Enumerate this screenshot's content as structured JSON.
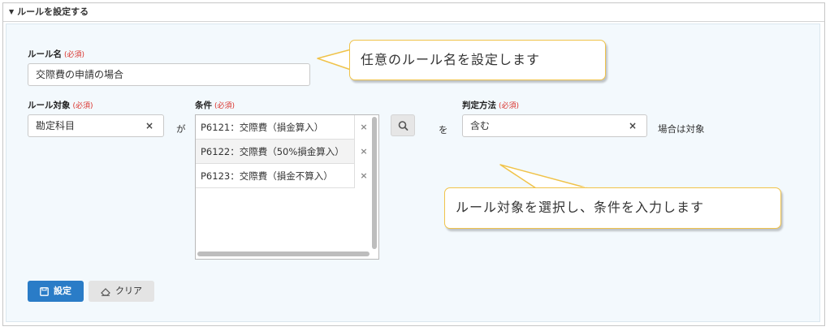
{
  "section": {
    "title": "ルールを設定する"
  },
  "rule_name": {
    "label": "ルール名",
    "required": "(必須)",
    "value": "交際費の申請の場合"
  },
  "rule_target": {
    "label": "ルール対象",
    "required": "(必須)",
    "value": "勘定科目",
    "clear": "×"
  },
  "particle_ga": "が",
  "condition": {
    "label": "条件",
    "required": "(必須)",
    "items": [
      {
        "label": "P6121：交際費（損金算入）",
        "remove": "×"
      },
      {
        "label": "P6122：交際費（50%損金算入）",
        "remove": "×"
      },
      {
        "label": "P6123：交際費（損金不算入）",
        "remove": "×"
      }
    ]
  },
  "particle_wo": "を",
  "judgement": {
    "label": "判定方法",
    "required": "(必須)",
    "value": "含む",
    "clear": "×",
    "suffix": "場合は対象"
  },
  "callouts": {
    "rule_name_hint": "任意のルール名を設定します",
    "target_hint": "ルール対象を選択し、条件を入力します"
  },
  "buttons": {
    "set": "設定",
    "clear": "クリア"
  },
  "colors": {
    "primary": "#2a7cc7",
    "required": "#d9312a",
    "callout_border": "#f0c34a",
    "panel_bg": "#f3f9fd"
  }
}
